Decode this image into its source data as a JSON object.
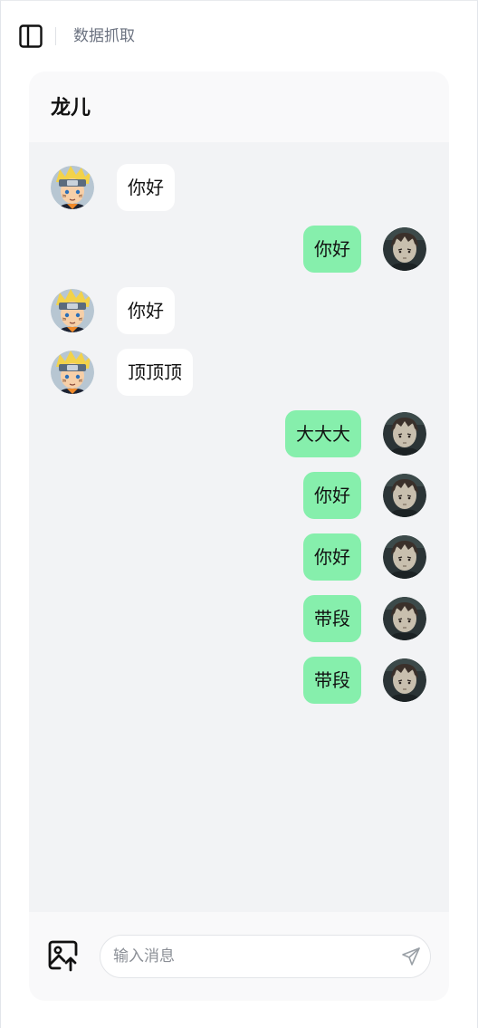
{
  "topbar": {
    "title": "数据抓取",
    "toggle_icon": "sidebar-panel-icon"
  },
  "chat": {
    "contact_name": "龙儿",
    "messages": [
      {
        "side": "left",
        "text": "你好",
        "avatar": "naruto-avatar"
      },
      {
        "side": "right",
        "text": "你好",
        "avatar": "dark-haired-avatar"
      },
      {
        "side": "left",
        "text": "你好",
        "avatar": "naruto-avatar"
      },
      {
        "side": "left",
        "text": "顶顶顶",
        "avatar": "naruto-avatar"
      },
      {
        "side": "right",
        "text": "大大大",
        "avatar": "dark-haired-avatar"
      },
      {
        "side": "right",
        "text": "你好",
        "avatar": "dark-haired-avatar"
      },
      {
        "side": "right",
        "text": "你好",
        "avatar": "dark-haired-avatar"
      },
      {
        "side": "right",
        "text": "带段",
        "avatar": "dark-haired-avatar"
      },
      {
        "side": "right",
        "text": "带段",
        "avatar": "dark-haired-avatar"
      }
    ]
  },
  "composer": {
    "placeholder": "输入消息",
    "value": "",
    "upload_icon": "image-upload-icon",
    "send_icon": "send-icon"
  },
  "colors": {
    "sent_bubble": "#86efac",
    "received_bubble": "#ffffff",
    "message_area": "#f2f3f5"
  }
}
